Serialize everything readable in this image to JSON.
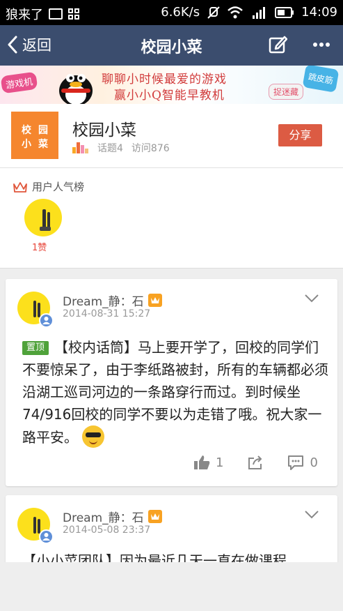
{
  "status_bar": {
    "carrier": "狼来了",
    "speed": "6.6K/s",
    "time": "14:09"
  },
  "nav": {
    "back_label": "返回",
    "title": "校园小菜"
  },
  "banner": {
    "tag_left": "游戏机",
    "line1": "聊聊小时候最爱的游戏",
    "line2": "赢小小Q智能早教机",
    "tag_mid": "捉迷藏",
    "tag_right": "跳皮筋"
  },
  "group": {
    "logo_chars": [
      "校",
      "园",
      "小",
      "菜"
    ],
    "name": "校园小菜",
    "topics": "话题4",
    "visits": "访问876",
    "share_label": "分享"
  },
  "popularity": {
    "title": "用户人气榜",
    "top_user_likes": "1赞"
  },
  "posts": [
    {
      "author": "Dream_静：石",
      "date": "2014-08-31 15:27",
      "pin_label": "置顶",
      "content": "【校内话筒】马上要开学了，回校的同学们不要惊呆了，由于李纸路被封，所有的车辆都必须沿湖工巡司河边的一条路穿行而过。到时候坐74/916回校的同学不要以为走错了哦。祝大家一路平安。",
      "like_count": "1",
      "comment_count": "0"
    },
    {
      "author": "Dream_静：石",
      "date": "2014-05-08 23:37",
      "content": "【小小菜团队】因为最近几天一直在做课程"
    }
  ],
  "colors": {
    "navbar": "#3b4d6e",
    "share": "#dc5b43",
    "logo": "#f5862e",
    "pin": "#4fa23a",
    "avatar": "#fce01c"
  }
}
